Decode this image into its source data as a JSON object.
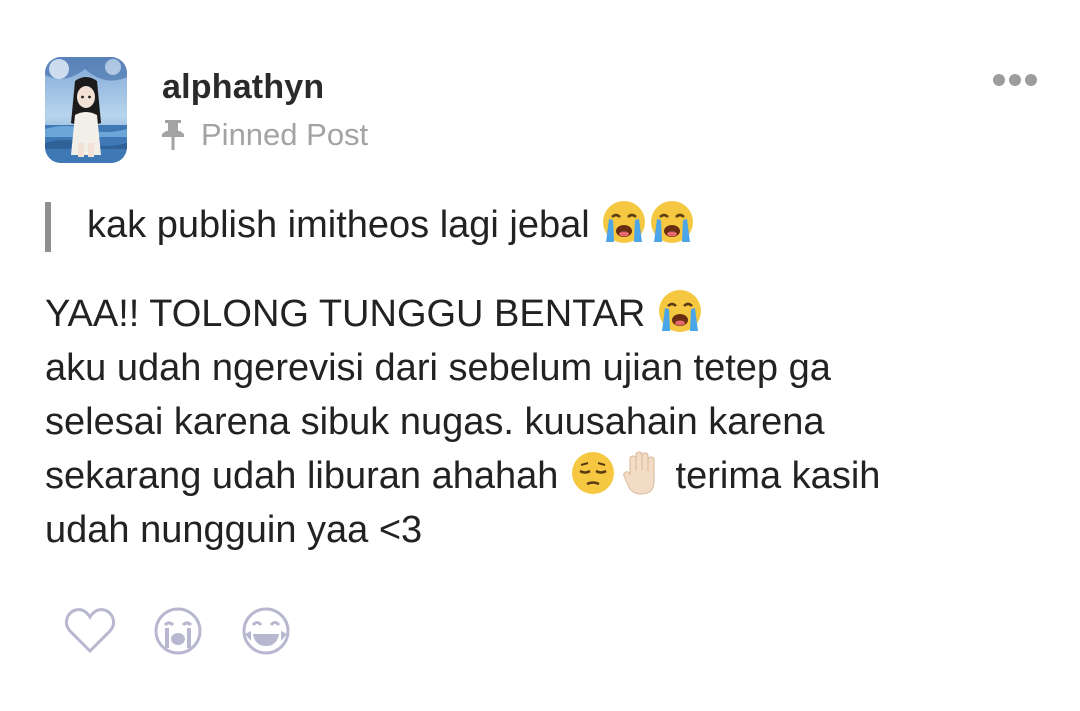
{
  "post": {
    "author": "alphathyn",
    "pinned_label": "Pinned Post",
    "quote": {
      "text": "kak publish imitheos lagi jebal",
      "emojis": [
        "crying-face",
        "crying-face"
      ]
    },
    "body": {
      "line1_text": "YAA!! TOLONG TUNGGU BENTAR",
      "line2": "aku udah ngerevisi dari sebelum ujian tetep ga",
      "line3": "selesai karena sibuk nugas. kuusahain karena",
      "line4_before": "sekarang udah liburan ahahah",
      "line4_after": "terima kasih",
      "line5": "udah nungguin yaa <3"
    }
  },
  "icons": {
    "pin": "pin-icon",
    "more": "more-horizontal-icon",
    "reactions": [
      "heart-icon",
      "crying-reaction-icon",
      "laughing-reaction-icon"
    ]
  },
  "colors": {
    "text": "#222222",
    "muted": "#a3a3a3",
    "quote_bar": "#8f8f8f",
    "reaction_outline": "#b7b7cf"
  }
}
